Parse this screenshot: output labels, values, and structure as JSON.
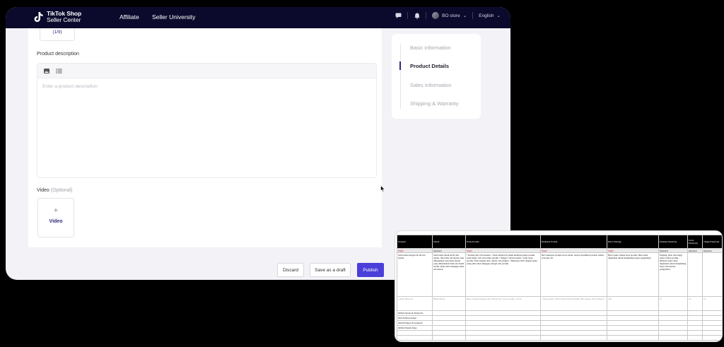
{
  "topnav": {
    "logo_line1": "TikTok Shop",
    "logo_line2": "Seller Center",
    "links": [
      "Affiliate",
      "Seller University"
    ],
    "store_name": "BO store",
    "language": "English"
  },
  "form": {
    "image_counter": "(1/9)",
    "description_label": "Product description",
    "description_placeholder": "Enter a product description",
    "video_label": "Video",
    "video_optional": "(Optional)",
    "video_button": "Video"
  },
  "steps": [
    "Basic information",
    "Product Details",
    "Sales Information",
    "Shipping & Warranty"
  ],
  "active_step": "Product Details",
  "footer": {
    "discard": "Discard",
    "save_draft": "Save as a draft",
    "publish": "Publish"
  },
  "spreadsheet": {
    "headers": [
      "Kategori",
      "Merek",
      "Nama Produk",
      "Deskripsi Produk",
      "Berat Paket(g)",
      "Panjang Paket(cm)",
      "Lebar Paket(cm)",
      "Tinggi Paket(cm)"
    ],
    "requirement": [
      "Wajib",
      "Opsional",
      "Wajib",
      "Wajib",
      "Wajib",
      "Opsional",
      "Opsional",
      "Opsional"
    ],
    "descriptions": [
      "Salin nama kategori & ID dari sistem.",
      "Salin nama merek & ID dari sistem. Jika tidak ada merek yang dimasukkan atau nama merek yang dimasukkan tidak ada dalam sistem, maka akan dianggap tidak ada merek.",
      "• Kurang dari 100 karakter. • Ikuti templat ini untuk membuat nama produk yang bagus: Seri atau nama produk + hingga 3 atribut utama + jenis dasar produk. Tulis dengan jelas, akurat, dan singkat. • Beberapa SKU dengan nama yang sama akan dianggap sebagai satu produk.",
      "Beri deskripsi produk secara detail, seperti spesifikasi produk, bahan, isi kotak, dll.",
      "Berat paket, bukan berat produk. Berat akan digunakan untuk menghitung biaya pengiriman.",
      "Panjang, lebar dan tinggi paket, bukan produk. Dimensi paket akan digunakan untuk menghitung biaya dan metode pengiriman.",
      "",
      ""
    ],
    "example": [
      "Lampu Hias/xxx",
      "BRAND/xxx",
      "Baju Lengan Panjang Ultra Katun Pria, Sayu (GAR), L Pack",
      "- Warna jaket: 100% Katun Warna Dijahit, 80% Katun, 20% Poliester",
      "180",
      "10",
      "10",
      "10"
    ],
    "categories": [
      "600621/Rotak & Tempat Pe",
      "600145/Pisau Dapur",
      "600185/Dapur & Sarung B",
      "600204/Taplak Meja"
    ]
  }
}
